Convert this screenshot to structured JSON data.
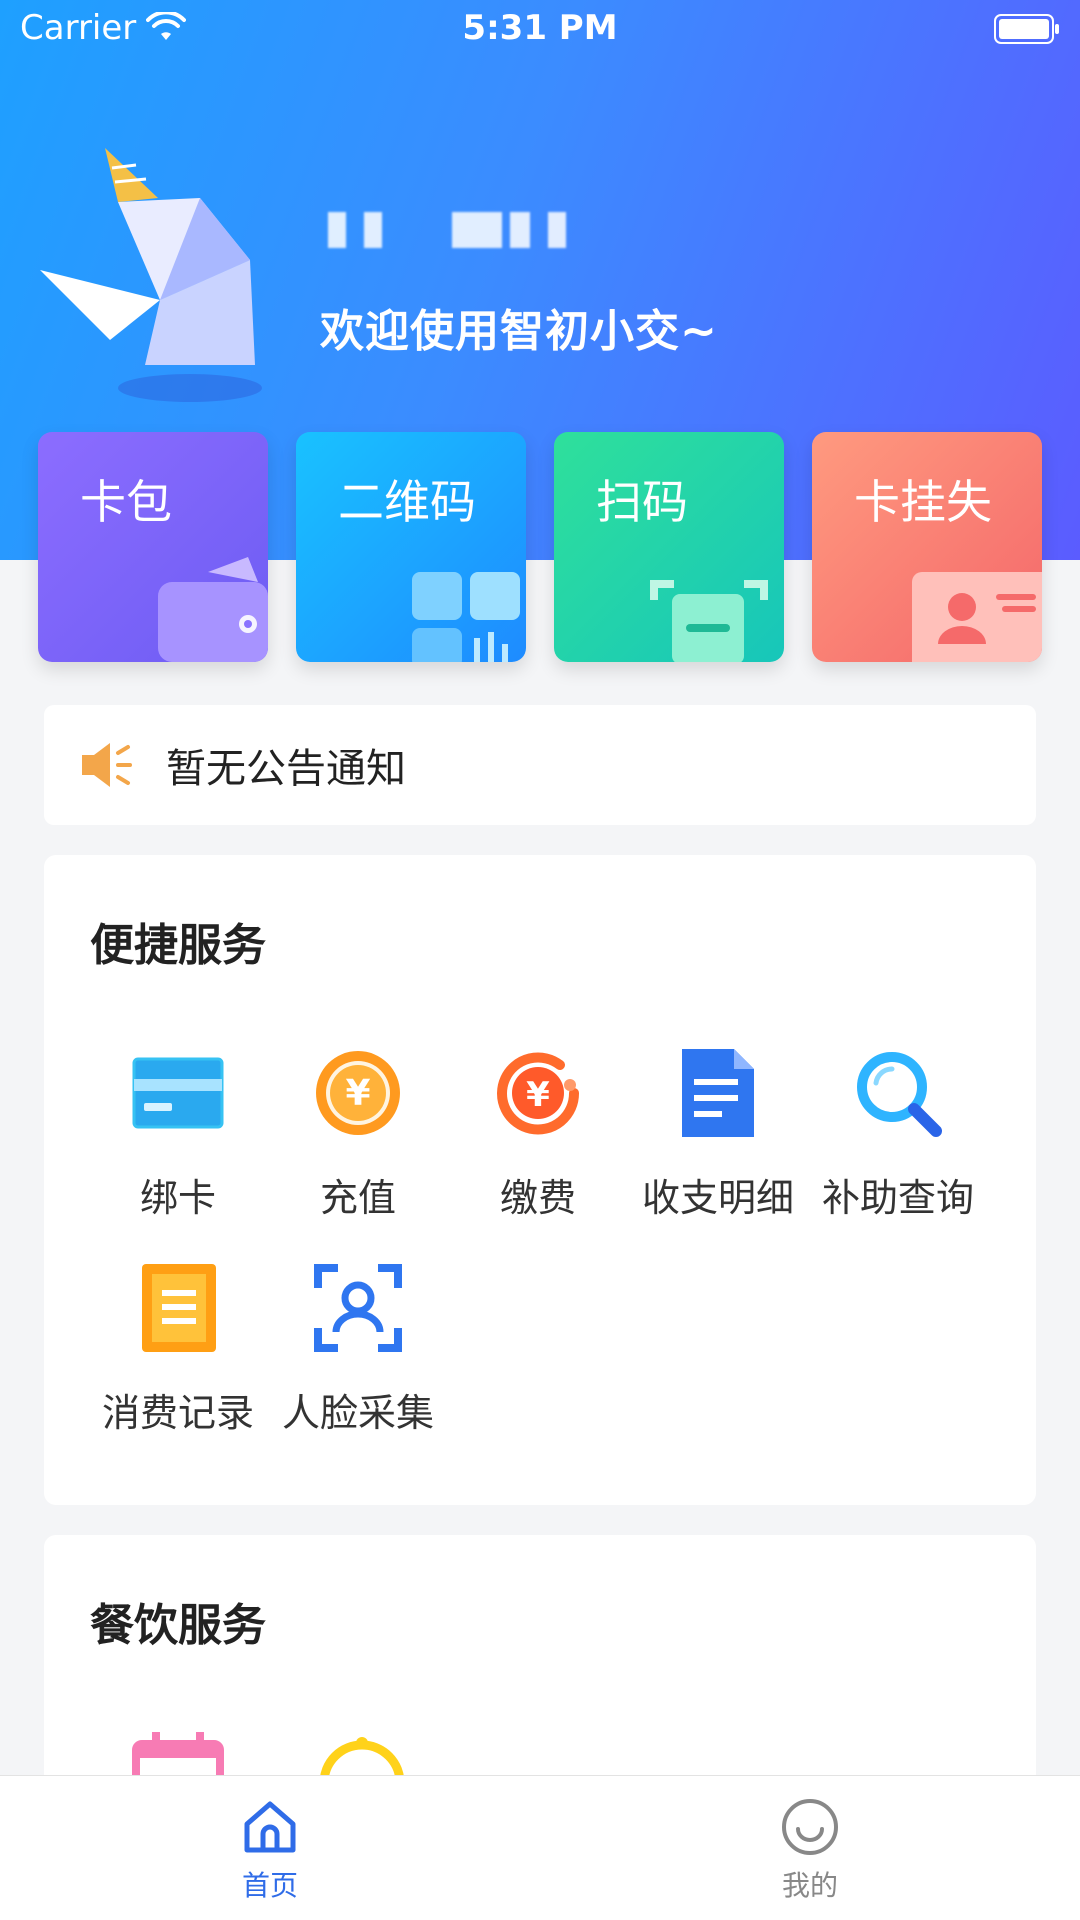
{
  "status_bar": {
    "carrier": "Carrier",
    "time": "5:31 PM"
  },
  "header": {
    "welcome": "欢迎使用智初小交~"
  },
  "quick_actions": [
    {
      "label": "卡包"
    },
    {
      "label": "二维码"
    },
    {
      "label": "扫码"
    },
    {
      "label": "卡挂失"
    }
  ],
  "notice": {
    "text": "暂无公告通知"
  },
  "services": {
    "title": "便捷服务",
    "items": [
      {
        "label": "绑卡",
        "icon": "bank-card-icon"
      },
      {
        "label": "充值",
        "icon": "yen-coin-icon"
      },
      {
        "label": "缴费",
        "icon": "yen-payment-icon"
      },
      {
        "label": "收支明细",
        "icon": "document-icon"
      },
      {
        "label": "补助查询",
        "icon": "magnifier-icon"
      },
      {
        "label": "消费记录",
        "icon": "record-list-icon"
      },
      {
        "label": "人脸采集",
        "icon": "face-scan-icon"
      }
    ]
  },
  "dining": {
    "title": "餐饮服务"
  },
  "tabbar": {
    "items": [
      {
        "label": "首页",
        "icon": "home-icon",
        "active": true
      },
      {
        "label": "我的",
        "icon": "smile-icon",
        "active": false
      }
    ]
  },
  "colors": {
    "accent": "#2f6ce8",
    "header_start": "#1ea0ff",
    "header_end": "#5b5cff"
  }
}
